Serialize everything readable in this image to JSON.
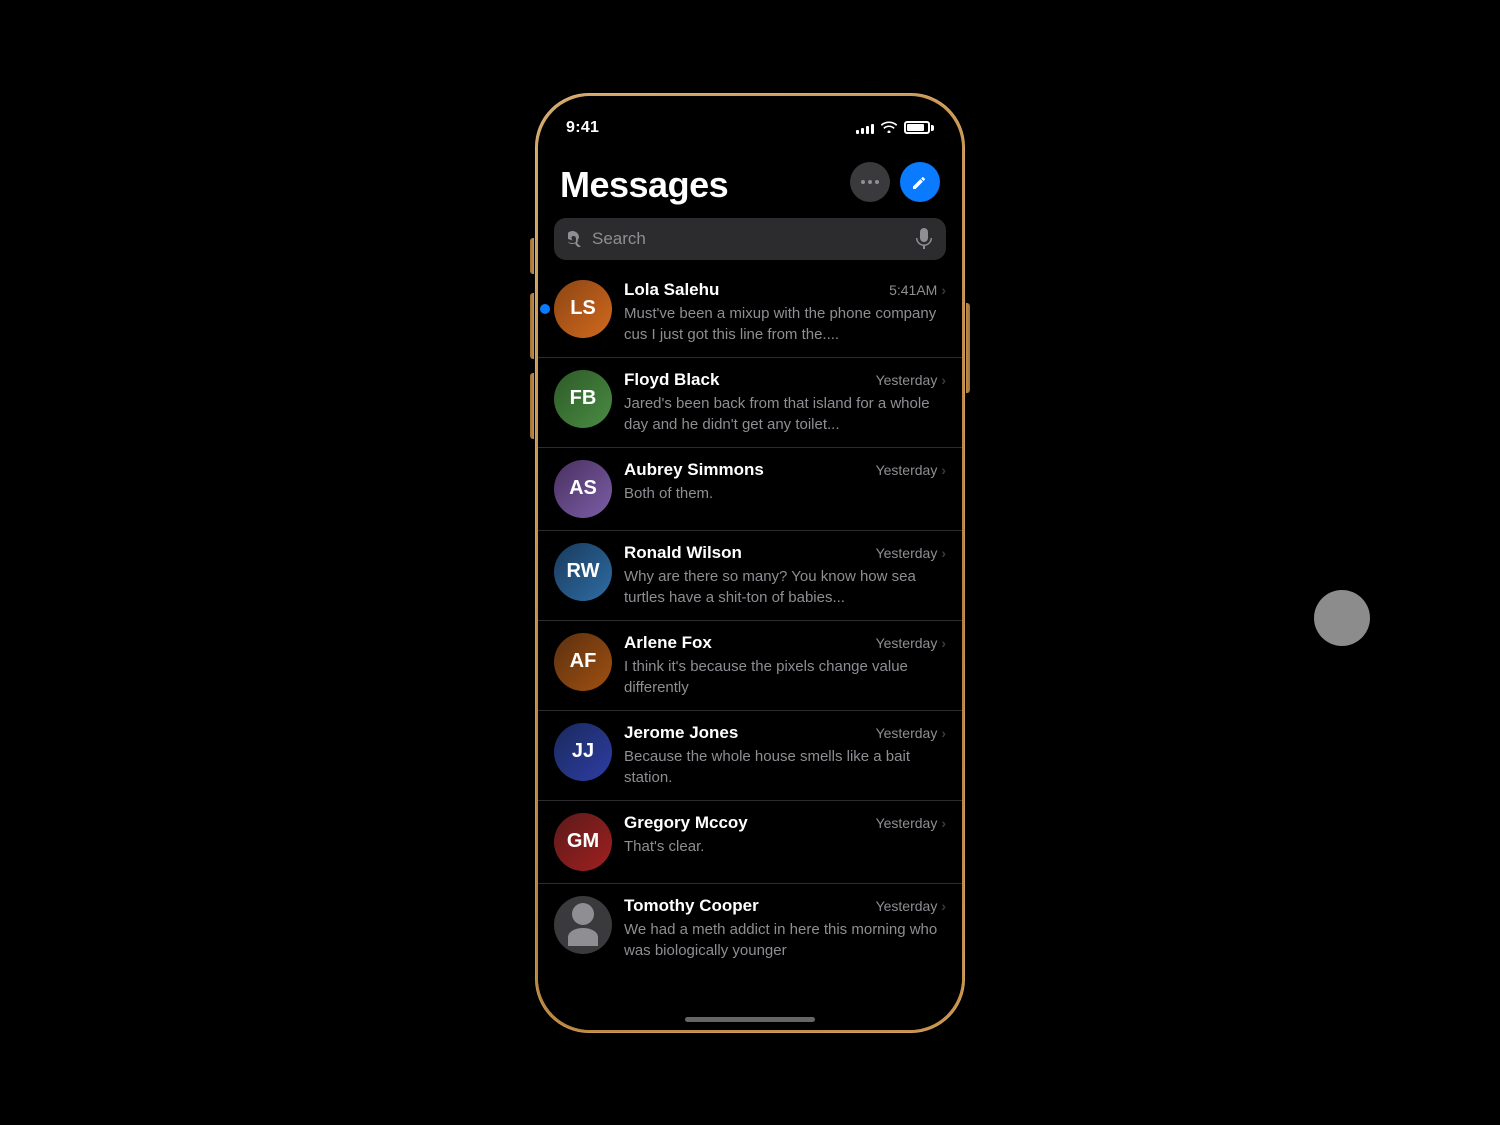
{
  "status_bar": {
    "time": "9:41",
    "signal_bars": [
      4,
      6,
      8,
      10,
      12
    ],
    "wifi": "wifi",
    "battery": 85
  },
  "header": {
    "title": "Messages",
    "dots_btn_label": "More",
    "compose_btn_label": "Compose"
  },
  "search": {
    "placeholder": "Search"
  },
  "conversations": [
    {
      "id": "lola",
      "name": "Lola Salehu",
      "time": "5:41AM",
      "preview": "Must've been a mixup with the phone company cus I just got this line from the....",
      "unread": true,
      "avatar_class": "avatar-lola",
      "avatar_initials": "LS"
    },
    {
      "id": "floyd",
      "name": "Floyd Black",
      "time": "Yesterday",
      "preview": "Jared's been back from that island for a whole day and he didn't get any toilet...",
      "unread": false,
      "avatar_class": "avatar-floyd",
      "avatar_initials": "FB"
    },
    {
      "id": "aubrey",
      "name": "Aubrey Simmons",
      "time": "Yesterday",
      "preview": "Both of them.",
      "unread": false,
      "avatar_class": "avatar-aubrey",
      "avatar_initials": "AS"
    },
    {
      "id": "ronald",
      "name": "Ronald Wilson",
      "time": "Yesterday",
      "preview": "Why are there so many? You know how sea turtles have a shit-ton of babies...",
      "unread": false,
      "avatar_class": "avatar-ronald",
      "avatar_initials": "RW"
    },
    {
      "id": "arlene",
      "name": "Arlene Fox",
      "time": "Yesterday",
      "preview": "I think it's because the pixels change value differently",
      "unread": false,
      "avatar_class": "avatar-arlene",
      "avatar_initials": "AF"
    },
    {
      "id": "jerome",
      "name": "Jerome Jones",
      "time": "Yesterday",
      "preview": "Because the whole house smells like a bait station.",
      "unread": false,
      "avatar_class": "avatar-jerome",
      "avatar_initials": "JJ"
    },
    {
      "id": "gregory",
      "name": "Gregory Mccoy",
      "time": "Yesterday",
      "preview": "That's clear.",
      "unread": false,
      "avatar_class": "avatar-gregory",
      "avatar_initials": "GM"
    },
    {
      "id": "tomothy",
      "name": "Tomothy Cooper",
      "time": "Yesterday",
      "preview": "We had a meth addict in here this morning who was biologically younger",
      "unread": false,
      "avatar_class": "avatar-tomothy",
      "avatar_initials": "",
      "is_generic": true
    }
  ]
}
